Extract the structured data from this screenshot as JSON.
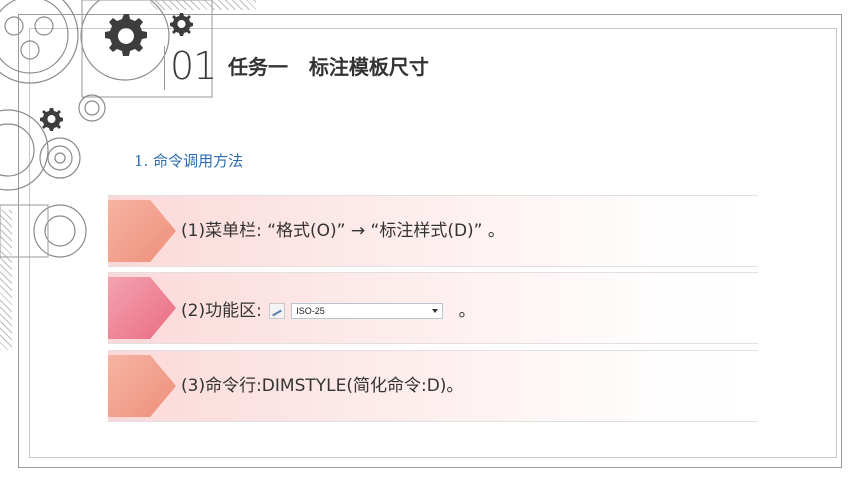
{
  "heading": {
    "number": "01",
    "title": "任务一   标注模板尺寸"
  },
  "section": {
    "label": "1. 命令调用方法"
  },
  "items": [
    {
      "text": "(1)菜单栏: “格式(O)” → “标注样式(D)” 。",
      "accent": "orange"
    },
    {
      "prefix": "(2)功能区: ",
      "control_value": "ISO-25",
      "suffix": " 。",
      "accent": "pink"
    },
    {
      "text": "(3)命令行:DIMSTYLE(简化命令:D)。",
      "accent": "orange"
    }
  ],
  "colors": {
    "section_label": "#2e6cb0",
    "arrow_orange": "#ee8f7a",
    "arrow_pink": "#e96b80",
    "row_background": "#fbd6d6"
  }
}
